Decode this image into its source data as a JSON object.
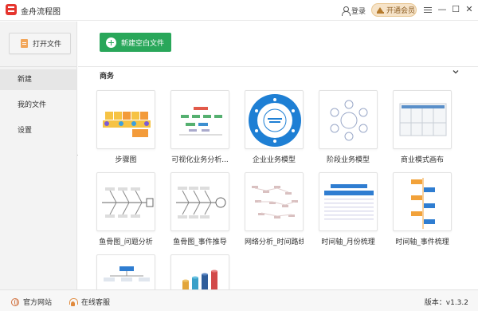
{
  "window": {
    "title": "金舟流程图",
    "login_label": "登录",
    "vip_label": "开通会员",
    "menu_icon": "menu-icon",
    "minimize_glyph": "—",
    "maximize_glyph": "☐",
    "close_glyph": "✕"
  },
  "sidebar": {
    "open_file_label": "打开文件",
    "items": [
      {
        "label": "新建",
        "active": true
      },
      {
        "label": "我的文件",
        "active": false
      },
      {
        "label": "设置",
        "active": false
      }
    ]
  },
  "main": {
    "new_blank_label": "新建空白文件",
    "section_title": "商务",
    "templates": [
      {
        "label": "步骤图",
        "icon": "step-chart-thumbnail"
      },
      {
        "label": "可视化业务分析...",
        "icon": "business-analysis-thumbnail"
      },
      {
        "label": "企业业务模型",
        "icon": "circular-model-thumbnail"
      },
      {
        "label": "阶段业务模型",
        "icon": "stage-model-thumbnail"
      },
      {
        "label": "商业模式画布",
        "icon": "canvas-thumbnail"
      },
      {
        "label": "鱼骨图_问题分析",
        "icon": "fishbone-thumbnail"
      },
      {
        "label": "鱼骨图_事件推导",
        "icon": "fishbone-thumbnail"
      },
      {
        "label": "网络分析_时间路线",
        "icon": "network-thumbnail"
      },
      {
        "label": "时间轴_月份梳理",
        "icon": "timeline-month-thumbnail"
      },
      {
        "label": "时间轴_事件梳理",
        "icon": "timeline-event-thumbnail"
      },
      {
        "label": "",
        "icon": "tree-thumbnail"
      },
      {
        "label": "",
        "icon": "cylinder-chart-thumbnail"
      }
    ]
  },
  "footer": {
    "website_label": "官方网站",
    "service_label": "在线客服",
    "version_label": "版本：v1.3.2"
  },
  "colors": {
    "accent_green": "#29a75a",
    "brand_red": "#e5352e",
    "vip_gold": "#f6e3c8"
  }
}
